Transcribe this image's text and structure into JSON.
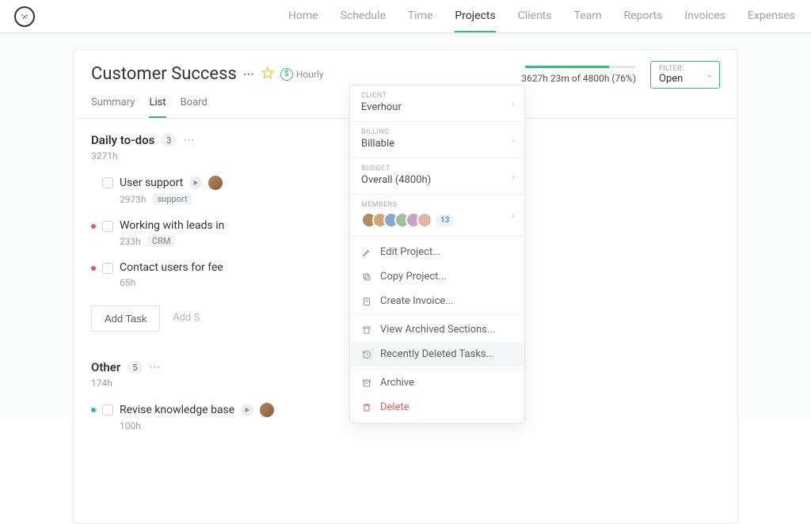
{
  "nav": {
    "items": [
      "Home",
      "Schedule",
      "Time",
      "Projects",
      "Clients",
      "Team",
      "Reports",
      "Invoices",
      "Expenses"
    ],
    "activeIndex": 3
  },
  "project": {
    "title": "Customer Success",
    "billingLabel": "Hourly",
    "progress": {
      "pct": 76,
      "text": "3627h 23m of 4800h (76%)"
    },
    "filter": {
      "label": "FILTER:",
      "value": "Open"
    },
    "tabs": [
      "Summary",
      "List",
      "Board"
    ],
    "activeTab": 1
  },
  "panel": {
    "client": {
      "label": "CLIENT",
      "value": "Everhour"
    },
    "billing": {
      "label": "BILLING",
      "value": "Billable"
    },
    "budget": {
      "label": "BUDGET",
      "value": "Overall (4800h)"
    },
    "members": {
      "label": "MEMBERS",
      "extra": "13"
    },
    "actions": {
      "edit": "Edit Project...",
      "copy": "Copy Project...",
      "invoice": "Create Invoice...",
      "archivedSections": "View Archived Sections...",
      "deletedTasks": "Recently Deleted Tasks...",
      "archive": "Archive",
      "delete": "Delete"
    }
  },
  "sections": [
    {
      "title": "Daily to-dos",
      "count": "3",
      "sub": "3271h",
      "tasks": [
        {
          "dot": "none",
          "title": "User support",
          "sub": "2973h",
          "tag": "support",
          "play": true,
          "avatar": true
        },
        {
          "dot": "red",
          "title": "Working with leads in",
          "sub": "233h",
          "tag": "CRM",
          "play": false,
          "avatar": false
        },
        {
          "dot": "red",
          "title": "Contact users for fee",
          "sub": "65h",
          "tag": "",
          "play": false,
          "avatar": false
        }
      ]
    },
    {
      "title": "Other",
      "count": "5",
      "sub": "174h",
      "tasks": [
        {
          "dot": "blue",
          "title": "Revise knowledge base",
          "sub": "100h",
          "tag": "",
          "play": true,
          "avatar": true
        }
      ]
    }
  ],
  "addRow": {
    "task": "Add Task",
    "section": "Add S"
  },
  "memberColors": [
    "#b58a5a",
    "#d4a373",
    "#86a8d8",
    "#9fbf9f",
    "#c8a2c8",
    "#e3b6a1"
  ]
}
